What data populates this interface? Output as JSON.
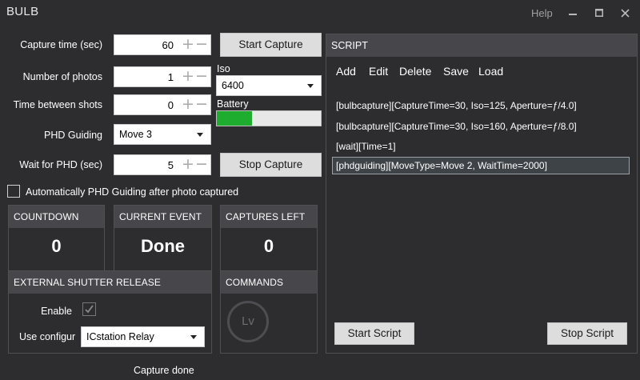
{
  "window": {
    "title": "BULB",
    "help": "Help",
    "minimize_icon": "minimize-icon",
    "maximize_icon": "maximize-icon",
    "close_icon": "close-icon"
  },
  "capture": {
    "capture_time_label": "Capture time (sec)",
    "capture_time_value": "60",
    "num_photos_label": "Number of photos",
    "num_photos_value": "1",
    "time_between_label": "Time between shots",
    "time_between_value": "0",
    "phd_guiding_label": "PHD Guiding",
    "phd_guiding_value": "Move 3",
    "wait_phd_label": "Wait for PHD (sec)",
    "wait_phd_value": "5",
    "start_button": "Start Capture",
    "stop_button": "Stop Capture",
    "iso_label": "Iso",
    "iso_value": "6400",
    "battery_label": "Battery",
    "battery_level": 0.34,
    "battery_color": "#1fad2f",
    "auto_phd_label": "Automatically PHD Guiding after photo captured",
    "auto_phd_checked": false,
    "plus_glyph": "+",
    "minus_glyph": "−"
  },
  "status_panels": {
    "countdown_title": "COUNTDOWN",
    "countdown_value": "0",
    "current_event_title": "CURRENT EVENT",
    "current_event_value": "Done",
    "captures_left_title": "CAPTURES LEFT",
    "captures_left_value": "0"
  },
  "external_shutter": {
    "title": "EXTERNAL SHUTTER RELEASE",
    "enable_label": "Enable",
    "enable_checked": true,
    "config_label": "Use configur",
    "config_value": "ICstation  Relay"
  },
  "commands": {
    "title": "COMMANDS",
    "lv_label": "Lv"
  },
  "script": {
    "title": "SCRIPT",
    "menu": [
      "Add",
      "Edit",
      "Delete",
      "Save",
      "Load"
    ],
    "lines": [
      "[bulbcapture][CaptureTime=30, Iso=125, Aperture=ƒ/4.0]",
      "[bulbcapture][CaptureTime=30, Iso=160, Aperture=ƒ/8.0]",
      "[wait][Time=1]",
      "[phdguiding][MoveType=Move 2, WaitTime=2000]"
    ],
    "selected_index": 3,
    "start_button": "Start Script",
    "stop_button": "Stop Script"
  },
  "status_bar": {
    "text": "Capture done"
  }
}
